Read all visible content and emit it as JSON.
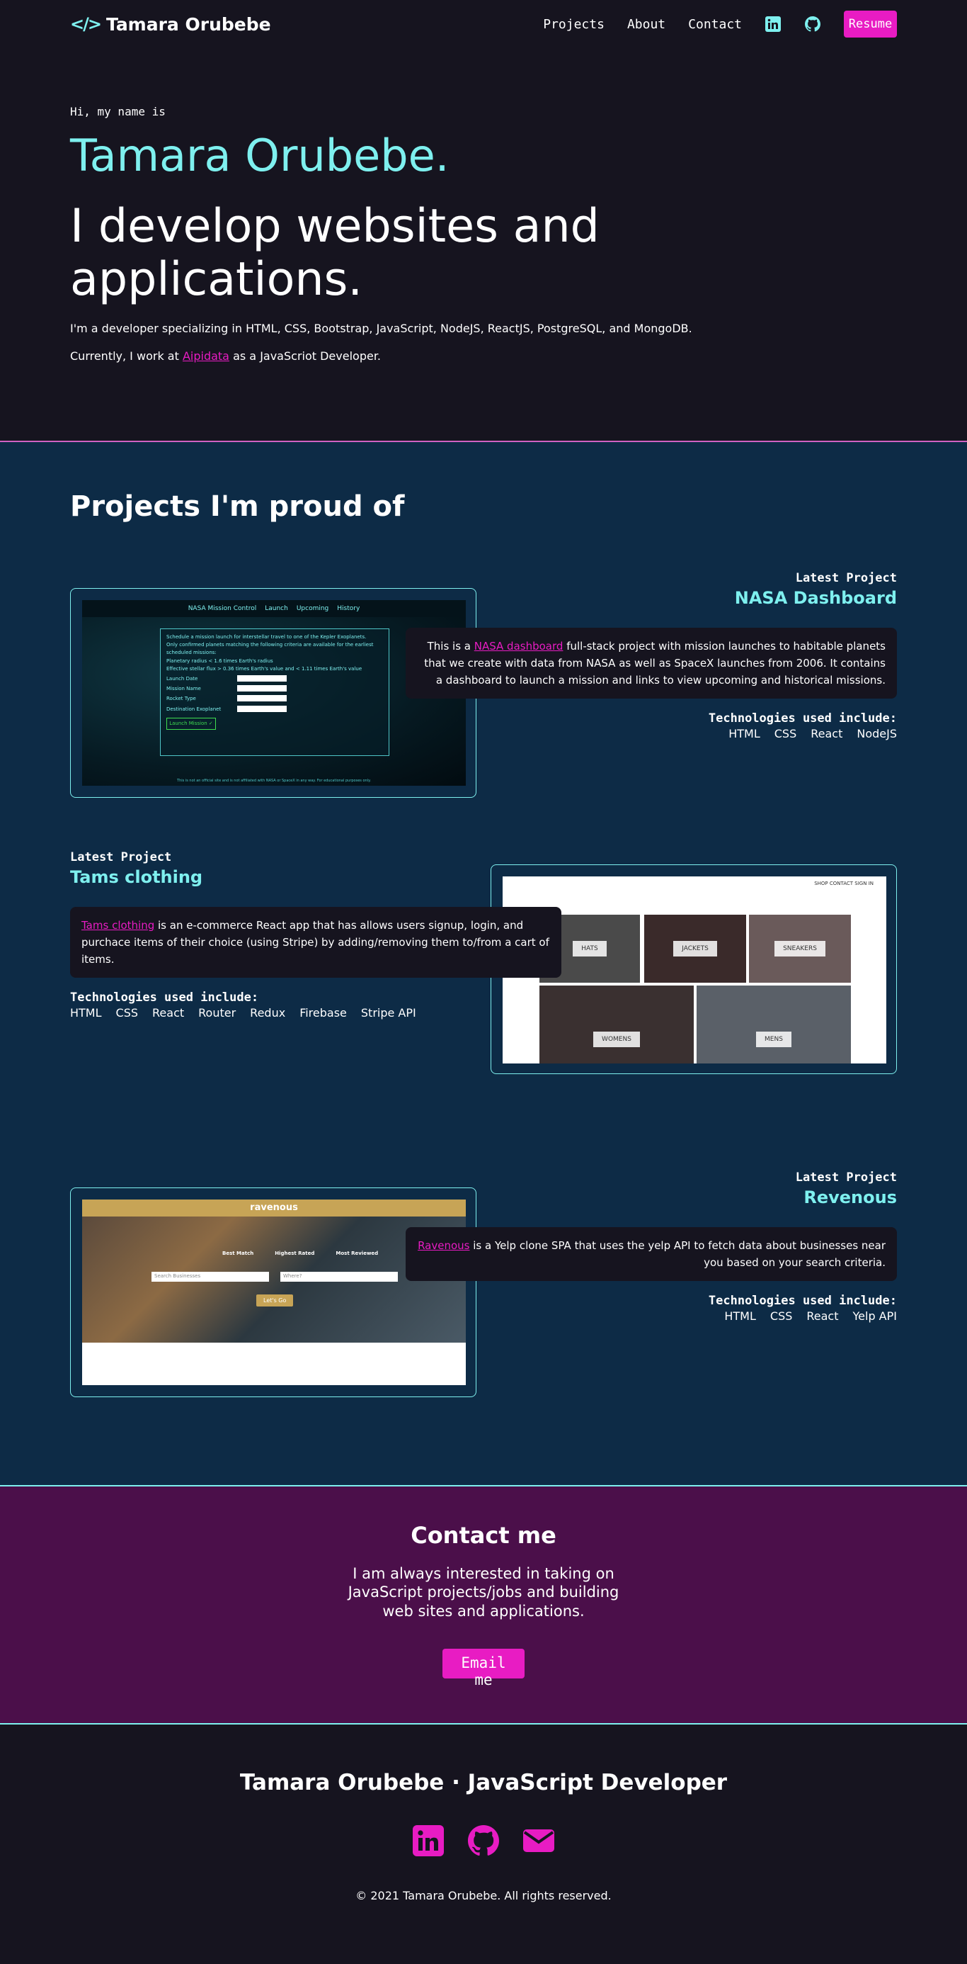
{
  "nav": {
    "brand_icon": "</>",
    "brand_name": "Tamara Orubebe",
    "links": [
      "Projects",
      "About",
      "Contact"
    ],
    "icons": [
      "linkedin-icon",
      "github-icon"
    ],
    "resume_label": "Resume"
  },
  "hero": {
    "greeting": "Hi, my name is",
    "name": "Tamara Orubebe.",
    "tagline": "I develop websites and applications.",
    "skills": "I'm a developer specializing in HTML, CSS, Bootstrap, JavaScript, NodeJS, ReactJS, PostgreSQL, and MongoDB.",
    "current_prefix": "Currently, I work at ",
    "current_company": "Aipidata",
    "current_suffix": " as a JavaScriot Developer."
  },
  "projects": {
    "title": "Projects I'm proud of",
    "items": [
      {
        "label": "Latest Project",
        "title": "NASA Dashboard",
        "desc_prefix": "This is a ",
        "link": "NASA dashboard",
        "desc_suffix": " full-stack project with mission launches to habitable planets that we create with data from NASA as well as SpaceX launches from 2006. It contains a dashboard to launch a mission and links to view upcoming and historical missions.",
        "tech_label": "Technologies used include:",
        "tech": [
          "HTML",
          "CSS",
          "React",
          "NodeJS"
        ]
      },
      {
        "label": "Latest Project",
        "title": "Tams clothing",
        "desc_prefix": "",
        "link": "Tams clothing",
        "desc_suffix": " is an e-commerce React app that has allows users signup, login, and purchace items of their choice (using Stripe) by adding/removing them to/from a cart of items.",
        "tech_label": "Technologies used include:",
        "tech": [
          "HTML",
          "CSS",
          "React",
          "Router",
          "Redux",
          "Firebase",
          "Stripe API"
        ]
      },
      {
        "label": "Latest Project",
        "title": "Revenous",
        "desc_prefix": "",
        "link": "Ravenous",
        "desc_suffix": " is a Yelp clone SPA that uses the yelp API to fetch data about businesses near you based on your search criteria.",
        "tech_label": "Technologies used include:",
        "tech": [
          "HTML",
          "CSS",
          "React",
          "Yelp API"
        ]
      }
    ],
    "nasa_shot": {
      "title": "NASA Mission Control",
      "nav": [
        "Launch",
        "Upcoming",
        "History"
      ],
      "intro": "Schedule a mission launch for interstellar travel to one of the Kepler Exoplanets.",
      "note": "Only confirmed planets matching the following criteria are available for the earliest scheduled missions:",
      "criteria": [
        "Planetary radius < 1.6 times Earth's radius",
        "Effective stellar flux > 0.36 times Earth's value and < 1.11 times Earth's value"
      ],
      "fields": [
        "Launch Date",
        "Mission Name",
        "Rocket Type",
        "Destination Exoplanet"
      ],
      "button": "Launch Mission ✓",
      "footer": "This is not an official site and is not affiliated with NASA or SpaceX in any way. For educational purposes only."
    },
    "tams_shot": {
      "nav": "SHOP    CONTACT    SIGN IN",
      "tiles": [
        "HATS",
        "JACKETS",
        "SNEAKERS",
        "WOMENS",
        "MENS"
      ]
    },
    "rav_shot": {
      "title": "ravenous",
      "sort": [
        "Best Match",
        "Highest Rated",
        "Most Reviewed"
      ],
      "search_placeholder": "Search Businesses",
      "where_placeholder": "Where?",
      "go": "Let's Go"
    }
  },
  "contact": {
    "title": "Contact me",
    "text": "I am always interested in taking on JavaScript projects/jobs and building web sites and applications.",
    "button": "Email me"
  },
  "footer": {
    "title": "Tamara Orubebe · JavaScript Developer",
    "icons": [
      "linkedin-icon",
      "github-icon",
      "envelope-icon"
    ],
    "copyright": "© 2021 Tamara Orubebe. All rights reserved."
  },
  "colors": {
    "background": "#16141f",
    "accent_cyan": "#7ef0ef",
    "accent_pink": "#e81cc3",
    "projects_bg": "#0d2b46",
    "contact_bg": "#4b0f4a"
  }
}
